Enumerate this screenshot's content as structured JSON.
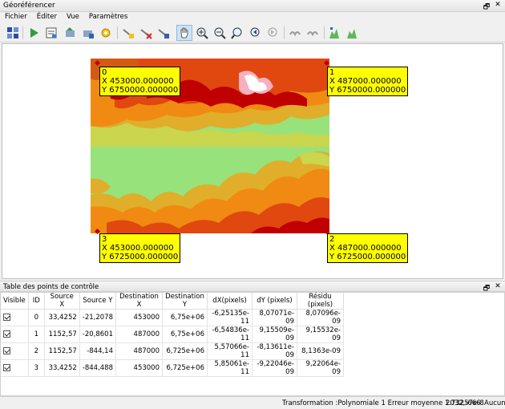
{
  "window": {
    "title": "Géoréférencer",
    "dock_restore": "🗗",
    "dock_close": "✕"
  },
  "menu": [
    "Fichier",
    "Éditer",
    "Vue",
    "Paramètres"
  ],
  "toolbar": {
    "icons": [
      "open-raster-icon",
      "start-georeferencing-icon",
      "generate-gdal-script-icon",
      "load-gcp-icon",
      "save-gcp-icon",
      "transformation-settings-icon",
      "add-point-icon",
      "delete-point-icon",
      "move-gcp-icon",
      "pan-icon",
      "zoom-in-icon",
      "zoom-out-icon",
      "zoom-to-layer-icon",
      "zoom-last-icon",
      "zoom-next-icon",
      "link-georef-to-qgis-icon",
      "link-qgis-to-georef-icon",
      "full-histogram-stretch-icon",
      "local-histogram-stretch-icon"
    ]
  },
  "gcps": [
    {
      "id": "0",
      "x": "X 453000.000000",
      "y": "Y 6750000.000000"
    },
    {
      "id": "1",
      "x": "X 487000.000000",
      "y": "Y 6750000.000000"
    },
    {
      "id": "2",
      "x": "X 487000.000000",
      "y": "Y 6725000.000000"
    },
    {
      "id": "3",
      "x": "X 453000.000000",
      "y": "Y 6725000.000000"
    }
  ],
  "table": {
    "title": "Table des points de contrôle",
    "headers": [
      "Visible",
      "ID",
      "Source X",
      "Source Y",
      "Destination X",
      "Destination Y",
      "dX(pixels)",
      "dY (pixels)",
      "Résidu (pixels)"
    ],
    "rows": [
      {
        "id": "0",
        "sx": "33,4252",
        "sy": "-21,2078",
        "dx": "453000",
        "dy": "6,75e+06",
        "dxp": "-6,25135e-11",
        "dyp": "8,07071e-09",
        "res": "8,07096e-09"
      },
      {
        "id": "1",
        "sx": "1152,57",
        "sy": "-20,8601",
        "dx": "487000",
        "dy": "6,75e+06",
        "dxp": "-6,54836e-11",
        "dyp": "9,15509e-09",
        "res": "9,15532e-09"
      },
      {
        "id": "2",
        "sx": "1152,57",
        "sy": "-844,14",
        "dx": "487000",
        "dy": "6,725e+06",
        "dxp": "5,57066e-11",
        "dyp": "-8,13611e-09",
        "res": "8,1363e-09"
      },
      {
        "id": "3",
        "sx": "33,4252",
        "sy": "-844,488",
        "dx": "453000",
        "dy": "6,725e+06",
        "dxp": "5,85061e-11",
        "dyp": "-9,22046e-09",
        "res": "9,22064e-09"
      }
    ]
  },
  "status": {
    "transformation": "Transformation :Polynomiale 1 Erreur moyenne 1.73257e-8",
    "coords": "2032,-666",
    "crs": "Aucun"
  }
}
